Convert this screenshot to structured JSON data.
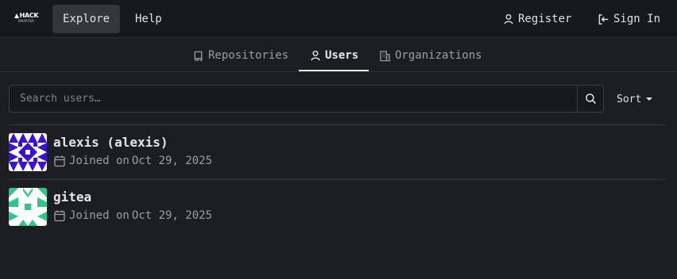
{
  "logo": {
    "top_text": "HACK",
    "bottom_text": "SMARTER"
  },
  "nav": {
    "explore": "Explore",
    "help": "Help",
    "register": "Register",
    "sign_in": "Sign In"
  },
  "tabs": [
    {
      "label": "Repositories",
      "icon": "repo-icon",
      "active": false
    },
    {
      "label": "Users",
      "icon": "user-icon",
      "active": true
    },
    {
      "label": "Organizations",
      "icon": "organization-icon",
      "active": false
    }
  ],
  "search": {
    "placeholder": "Search users…",
    "value": ""
  },
  "sort": {
    "label": "Sort"
  },
  "users": [
    {
      "name": "alexis (alexis)",
      "joined_label": "Joined on",
      "joined_date": "Oct 29, 2025",
      "avatar_color": "#3b10d8"
    },
    {
      "name": "gitea",
      "joined_label": "Joined on",
      "joined_date": "Oct 29, 2025",
      "avatar_color": "#2fc68c"
    }
  ],
  "colors": {
    "background": "#1c1e22",
    "navbar": "#17191c",
    "text": "#d6d8dc",
    "muted": "#9a9ea6"
  }
}
